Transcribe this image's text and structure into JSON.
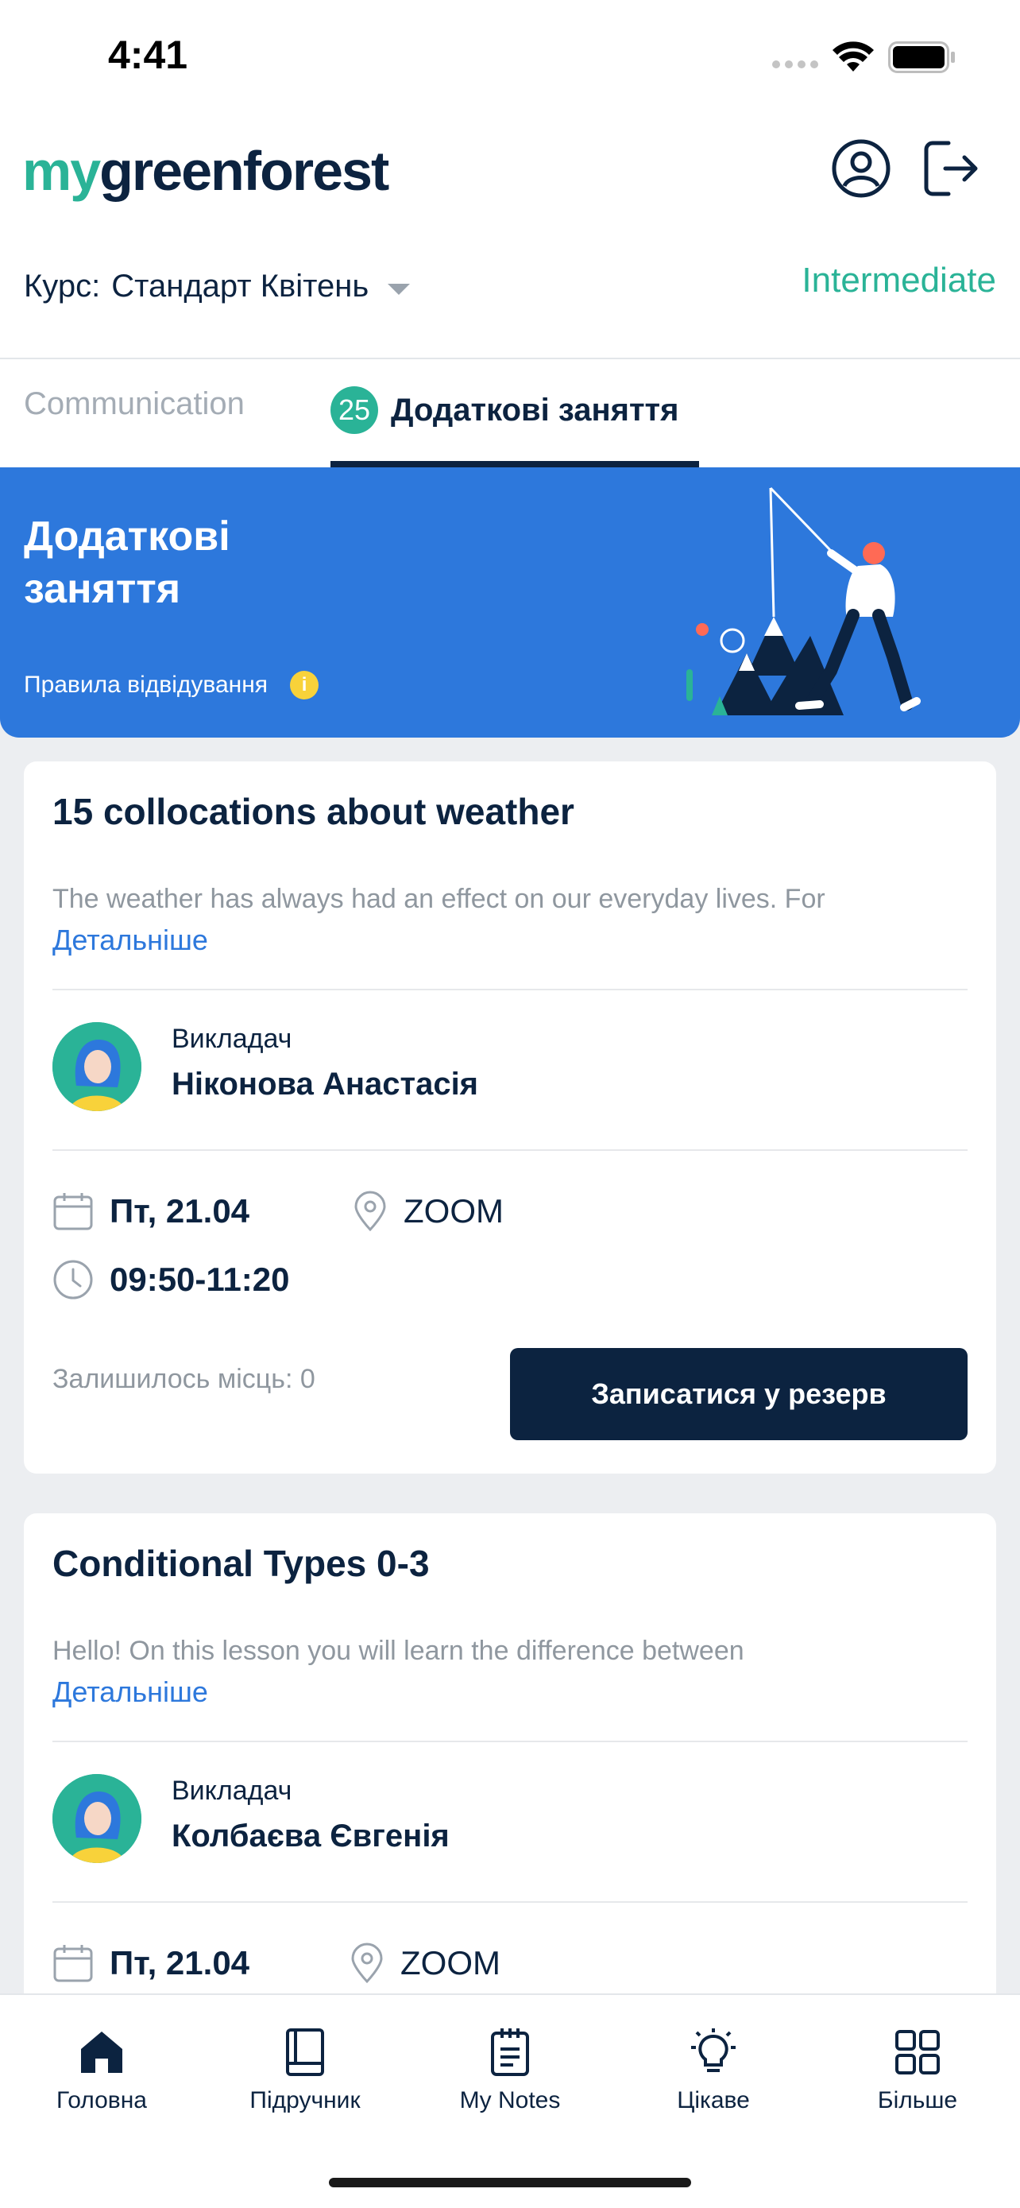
{
  "status_bar": {
    "time": "4:41"
  },
  "header": {
    "logo_prefix": "my",
    "logo_main": "greenforest",
    "course_label": "Курс:",
    "course_value": "Стандарт Квітень",
    "level": "Intermediate"
  },
  "tabs": [
    {
      "label": "Communication",
      "active": false
    },
    {
      "label": "Додаткові заняття",
      "badge": "25",
      "active": true
    }
  ],
  "banner": {
    "title": "Додаткові заняття",
    "rules_label": "Правила відвідування",
    "info_icon": "i"
  },
  "lessons": [
    {
      "title": "15 collocations about weather",
      "description": "The weather has always had an effect on our everyday lives. For",
      "more_label": "Детальніше",
      "teacher_label": "Викладач",
      "teacher_name": "Ніконова Анастасія",
      "date": "Пт, 21.04",
      "location": "ZOOM",
      "time": "09:50-11:20",
      "seats_left": "Залишилось місць: 0",
      "button_label": "Записатися у резерв"
    },
    {
      "title": "Conditional Types 0-3",
      "description": "Hello! On this lesson you will learn the difference between",
      "more_label": "Детальніше",
      "teacher_label": "Викладач",
      "teacher_name": "Колбаєва Євгенія",
      "date": "Пт, 21.04",
      "location": "ZOOM"
    }
  ],
  "bottom_nav": [
    {
      "label": "Головна",
      "icon": "home-icon",
      "active": true
    },
    {
      "label": "Підручник",
      "icon": "book-icon"
    },
    {
      "label": "My Notes",
      "icon": "notes-icon"
    },
    {
      "label": "Цікаве",
      "icon": "lightbulb-icon"
    },
    {
      "label": "Більше",
      "icon": "grid-icon"
    }
  ],
  "colors": {
    "brand_green": "#2ab397",
    "navy": "#0c2340",
    "banner_blue": "#2d78dc",
    "link_blue": "#2d78dc"
  }
}
